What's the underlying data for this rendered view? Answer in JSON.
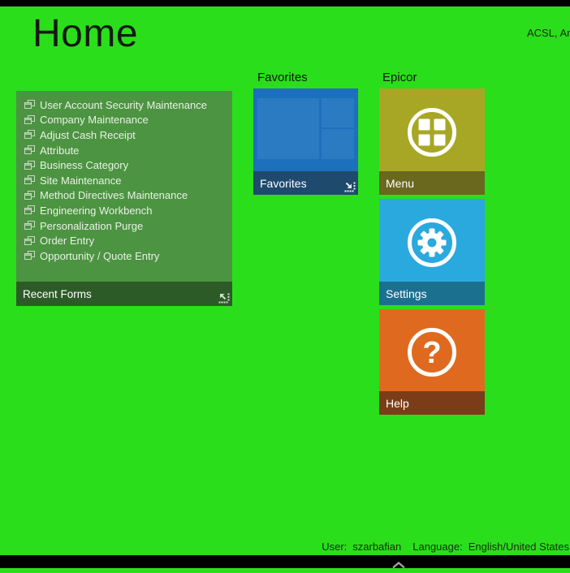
{
  "window": {
    "title": "Home",
    "company": "ACSL, Arg"
  },
  "recent_forms": {
    "caption": "Recent Forms",
    "items": [
      "User Account Security Maintenance",
      "Company Maintenance",
      "Adjust Cash Receipt",
      "Attribute",
      "Business Category",
      "Site Maintenance",
      "Method Directives Maintenance",
      "Engineering Workbench",
      "Personalization Purge",
      "Order Entry",
      "Opportunity / Quote Entry"
    ]
  },
  "favorites_group": {
    "header": "Favorites",
    "tile_caption": "Favorites"
  },
  "epicor_group": {
    "header": "Epicor",
    "tiles": [
      {
        "label": "Menu"
      },
      {
        "label": "Settings"
      },
      {
        "label": "Help"
      }
    ]
  },
  "status_bar": {
    "user_label": "User:",
    "user_value": "szarbafian",
    "language_label": "Language:",
    "language_value": "English/United States"
  },
  "colors": {
    "background": "#2BDE1B",
    "recent_panel": "#4C9441",
    "recent_caption": "#2D5B27",
    "favorites_tile": "#1C70BC",
    "favorites_caption": "#1E4A6D",
    "menu_tile": "#A8A725",
    "menu_caption": "#69681E",
    "settings_tile": "#2AA9DE",
    "settings_caption": "#1B7090",
    "help_tile": "#DF6A1F",
    "help_caption": "#7B3D19"
  }
}
